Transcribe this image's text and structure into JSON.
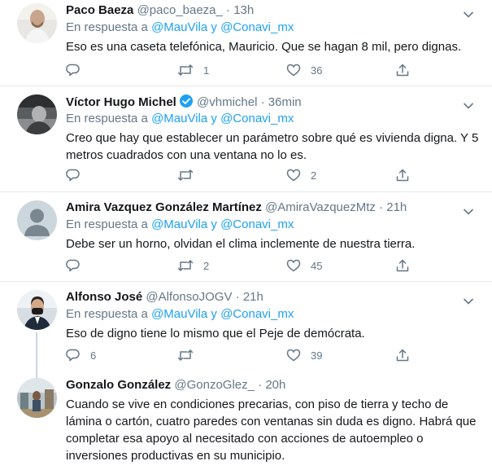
{
  "tweets": [
    {
      "name": "Paco Baeza",
      "handle": "@paco_baeza_",
      "dot": "·",
      "time": "13h",
      "verified": false,
      "reply_prefix": "En respuesta a",
      "mention1": "@MauVila",
      "reply_and": "y",
      "mention2": "@Conavi_mx",
      "text": "Eso es una caseta telefónica, Mauricio. Que se hagan 8 mil, pero dignas.",
      "reply_count": "",
      "retweet_count": "1",
      "like_count": "36"
    },
    {
      "name": "Víctor Hugo Michel",
      "handle": "@vhmichel",
      "dot": "·",
      "time": "36min",
      "verified": true,
      "reply_prefix": "En respuesta a",
      "mention1": "@MauVila",
      "reply_and": "y",
      "mention2": "@Conavi_mx",
      "text": "Creo que hay que establecer un parámetro sobre qué es vivienda digna. Y 5 metros cuadrados con una ventana no lo es.",
      "reply_count": "",
      "retweet_count": "",
      "like_count": "2"
    },
    {
      "name": "Amira Vazquez González Martínez",
      "handle": "@AmiraVazquezMtz",
      "dot": "·",
      "time": "21h",
      "verified": false,
      "reply_prefix": "En respuesta a",
      "mention1": "@MauVila",
      "reply_and": "y",
      "mention2": "@Conavi_mx",
      "text": "Debe ser un horno, olvidan el clima inclemente de nuestra tierra.",
      "reply_count": "",
      "retweet_count": "2",
      "like_count": "45"
    },
    {
      "name": "Alfonso José",
      "handle": "@AlfonsoJOGV",
      "dot": "·",
      "time": "21h",
      "verified": false,
      "reply_prefix": "En respuesta a",
      "mention1": "@MauVila",
      "reply_and": "y",
      "mention2": "@Conavi_mx",
      "text": "Eso de digno tiene lo mismo que el Peje de demócrata.",
      "reply_count": "6",
      "retweet_count": "",
      "like_count": "39"
    },
    {
      "name": "Gonzalo González",
      "handle": "@GonzoGlez_",
      "dot": "·",
      "time": "20h",
      "verified": false,
      "text": "Cuando se vive en condiciones precarias, con piso de tierra y techo de lámina o cartón, cuatro paredes con ventanas sin duda es digno. Habrá que completar esa apoyo al necesitado con acciones de autoempleo o inversiones productivas en su municipio."
    }
  ],
  "colors": {
    "accent": "#1da1f2",
    "muted": "#657786",
    "text": "#14171a",
    "divider": "#e6ecf0",
    "thread": "#ccd6dd"
  },
  "icons": [
    "chevron-down-icon",
    "reply-icon",
    "retweet-icon",
    "like-icon",
    "share-icon",
    "verified-icon"
  ]
}
